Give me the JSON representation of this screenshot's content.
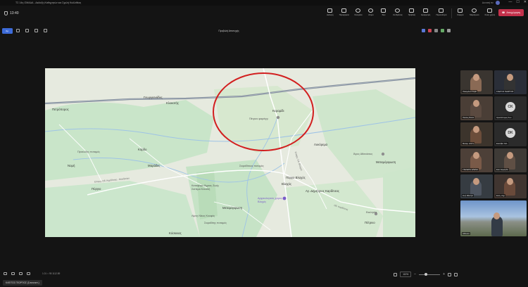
{
  "titlebar": {
    "app_title": "ΤΣ 14η ΟΜΑΔΑ - Διάλεξη Καθηγητών και Σχολή Καλλιθέας",
    "user": "Δυνατή πε",
    "minimize": "—",
    "maximize": "☐",
    "close": "✕"
  },
  "meeting": {
    "timer": "13:40",
    "tools": [
      {
        "name": "chat",
        "label": "Διαλογή"
      },
      {
        "name": "people",
        "label": "Περιεχόμενο"
      },
      {
        "name": "reactions",
        "label": "Συνομιλία"
      },
      {
        "name": "participants",
        "label": "Άτομα"
      },
      {
        "name": "raise",
        "label": "Χέρι"
      },
      {
        "name": "reactions2",
        "label": "Αντιδράσεις"
      },
      {
        "name": "view",
        "label": "Προβολή"
      },
      {
        "name": "rooms",
        "label": "Εφαρμογές"
      },
      {
        "name": "more",
        "label": "Περισσότερα"
      }
    ],
    "camera_label": "Κάμερα",
    "mic_label": "Μικρόφωνο",
    "share_label": "Κοινή χρήση",
    "leave_label": "Αποχώρηση"
  },
  "share": {
    "view_label": "Άρ.",
    "title": "Προβολή Αποτυχής"
  },
  "map": {
    "places": [
      {
        "id": "petroporos",
        "text": "Πετρόπορος"
      },
      {
        "id": "georgiana",
        "text": "Γεωργιανάδες"
      },
      {
        "id": "kloikotis",
        "text": "Κλοκοτής"
      },
      {
        "id": "keramidi",
        "text": "Κεραμίδι"
      },
      {
        "id": "petrino",
        "text": "Πέτρινο φαράγγι"
      },
      {
        "id": "lykorema",
        "text": "Λυκόρεμα"
      },
      {
        "id": "prinos",
        "text": "Πρινιώδης ποταμός"
      },
      {
        "id": "korfi",
        "text": "Κόρδο"
      },
      {
        "id": "noumi",
        "text": "Νομή"
      },
      {
        "id": "marades",
        "text": "Μαράδες"
      },
      {
        "id": "pyrgos",
        "text": "Πύργιο"
      },
      {
        "id": "sofades",
        "text": "Σοφαδίτικος ποταμός"
      },
      {
        "id": "vlachos",
        "text": "Πύργο Βλαχός"
      },
      {
        "id": "vlachos2",
        "text": "Βλαχός"
      },
      {
        "id": "agios_athanasios",
        "text": "Άγιος Αθανάσιος"
      },
      {
        "id": "metamorfosi_r",
        "text": "Μεταμόρφωση"
      },
      {
        "id": "dimitrios",
        "text": "Αγ. Δημήτριος Καρδίτσας"
      },
      {
        "id": "katafygio",
        "text": "Καταφύγιο Άγριας Ζωής Σιστέμα Κλειστή"
      },
      {
        "id": "arxaiologikos",
        "text": "Αρχαιολογικός χώρος Βλαχός"
      },
      {
        "id": "metamorfosi",
        "text": "Μεταμόρφωση"
      },
      {
        "id": "agios_nikos",
        "text": "Λίμνη Νίκος Κουφός"
      },
      {
        "id": "sofadi2",
        "text": "Σοφαδίτης ποταμός"
      },
      {
        "id": "koskinas",
        "text": "Κόσκινας"
      },
      {
        "id": "ekklisia",
        "text": "Εκκλησία"
      },
      {
        "id": "petrino2",
        "text": "Πέτρινο"
      },
      {
        "id": "rd1",
        "text": "Επαρχ. Οδ. Καρδίτσας - Μουζακίου"
      },
      {
        "id": "rd2",
        "text": "Επαρχ. Οδ. Βλαχού"
      },
      {
        "id": "rd3",
        "text": "Οδ. Καρδίτσας"
      }
    ]
  },
  "participants": [
    {
      "name": "Παλαμάκια Σοφία",
      "type": "photo"
    },
    {
      "name": "ΚΛΕΙΤΟΣ ΓΕΩΡΓΙΟΣ",
      "type": "photo"
    },
    {
      "name": "Παύλος Βασιλ",
      "type": "photo"
    },
    {
      "name": "Χρυσόστομος Κων",
      "initials": "CK"
    },
    {
      "name": "Μαλαμ. Ελένη",
      "type": "photo"
    },
    {
      "name": "Ελισάβετ Καλ",
      "initials": "DK"
    },
    {
      "name": "ΤΣΕΛΕΠΗ ΕΛΕΝΗ",
      "type": "photo"
    },
    {
      "name": "Ελισ Καραγιάν",
      "type": "photo"
    },
    {
      "name": "Ζωή Μάστρο",
      "type": "photo"
    },
    {
      "name": "Ευαγ. Δημ",
      "type": "photo"
    },
    {
      "name": "Αίθουσα",
      "type": "room"
    }
  ],
  "bottom": {
    "coords": "1.01 = 95   1112.89",
    "zoom": "113%"
  },
  "presenter": "ΚΛΕΙΤΟΣ ΓΕΩΡΓΙΟΣ (Συντονιστ.)"
}
